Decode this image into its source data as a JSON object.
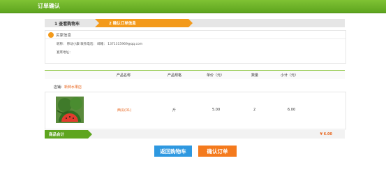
{
  "header": {
    "title": "订单确认"
  },
  "steps": [
    {
      "label": "1  查看购物车"
    },
    {
      "label": "2  确认订单信息"
    }
  ],
  "buyer": {
    "title": "买家信息",
    "contact": "昵称：  移动小康  联系电话：   邮箱： 1371315969@qq.com",
    "address": "宴席地址："
  },
  "table": {
    "headers": [
      "产品名称",
      "产品规格",
      "单价（元）",
      "数量",
      "小计（元）"
    ]
  },
  "store": {
    "label": "店铺：",
    "name": "新鲜水果店"
  },
  "product": {
    "image": "watermelon-image",
    "name": "西瓜(01)",
    "spec": "斤",
    "price": "5.00",
    "quantity": "2",
    "subtotal": "6.00"
  },
  "total": {
    "label": "商品合计",
    "value": "¥ 6.00"
  },
  "buttons": {
    "back": "返回购物车",
    "confirm": "确认订单"
  },
  "colors": {
    "header": "#6cb22a",
    "accent_orange": "#f39a1b",
    "back_button": "#2e98e0",
    "confirm_button": "#f47a1d"
  }
}
